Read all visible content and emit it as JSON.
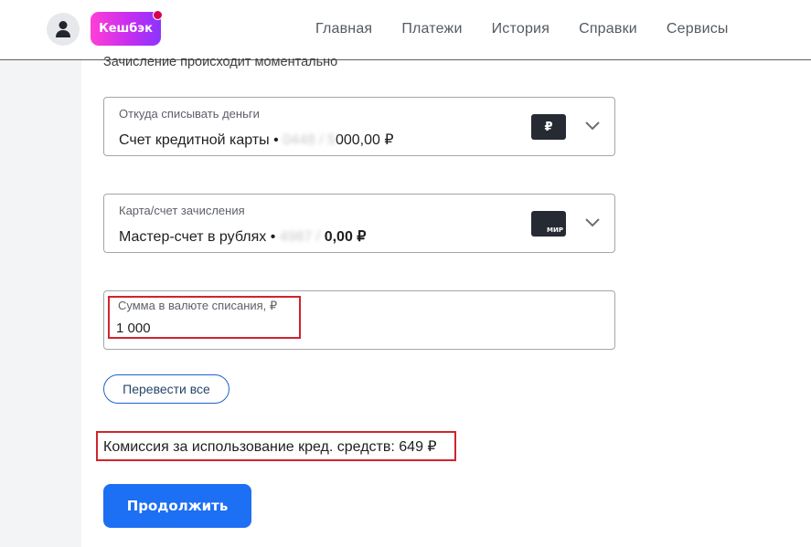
{
  "header": {
    "cashback_label": "Кешбэк",
    "nav": [
      "Главная",
      "Платежи",
      "История",
      "Справки",
      "Сервисы"
    ]
  },
  "subtitle": "Зачисление происходит моментально",
  "from_field": {
    "label": "Откуда списывать деньги",
    "account_name": "Счет кредитной карты •",
    "masked_number": "0448 /",
    "masked_balance": "  5",
    "balance": "000,00 ₽",
    "icon_symbol": "₽"
  },
  "to_field": {
    "label": "Карта/счет зачисления",
    "account_name": "Мастер-счет в рублях •",
    "masked_number": "4987 /",
    "balance": "0,00 ₽",
    "icon_symbol": "МИР"
  },
  "amount_field": {
    "label": "Сумма в валюте списания, ₽",
    "value": "1 000"
  },
  "transfer_all_label": "Перевести все",
  "commission_text": "Комиссия за использование кред. средств: 649 ₽",
  "continue_label": "Продолжить",
  "colors": {
    "primary": "#1d6ff3",
    "highlight": "#d0242e",
    "cashback_start": "#ff3fd6",
    "cashback_end": "#8a35ff"
  }
}
